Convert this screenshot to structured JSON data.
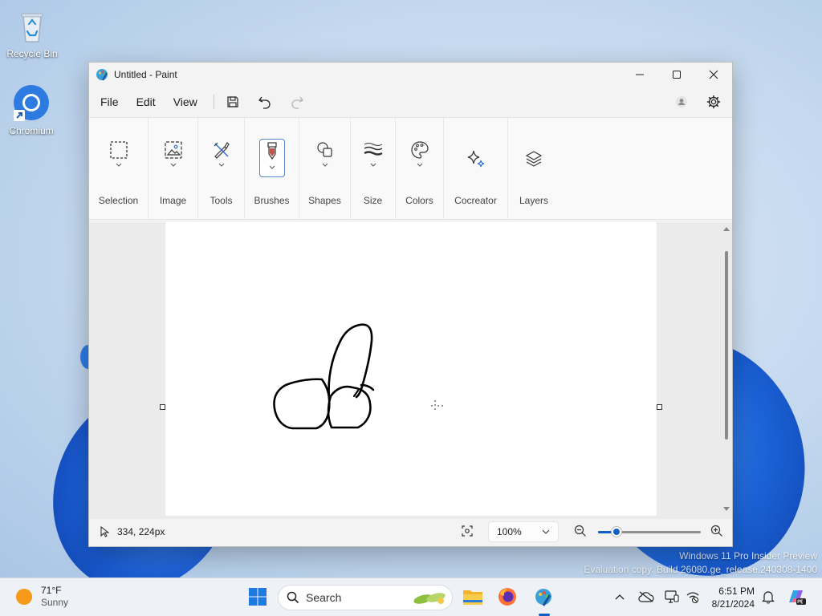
{
  "desktop": {
    "icons": [
      {
        "label": "Recycle Bin"
      },
      {
        "label": "Chromium"
      }
    ],
    "watermark": {
      "line1": "Windows 11 Pro Insider Preview",
      "line2": "Evaluation copy. Build 26080.ge_release.240308-1400"
    }
  },
  "window": {
    "title": "Untitled - Paint",
    "menu": {
      "file": "File",
      "edit": "Edit",
      "view": "View"
    },
    "ribbon": {
      "groups": [
        {
          "label": "Selection",
          "icon": "selection-icon"
        },
        {
          "label": "Image",
          "icon": "image-icon"
        },
        {
          "label": "Tools",
          "icon": "tools-icon"
        },
        {
          "label": "Brushes",
          "icon": "brush-icon"
        },
        {
          "label": "Shapes",
          "icon": "shapes-icon"
        },
        {
          "label": "Size",
          "icon": "size-icon"
        },
        {
          "label": "Colors",
          "icon": "palette-icon"
        },
        {
          "label": "Cocreator",
          "icon": "sparkle-icon"
        },
        {
          "label": "Layers",
          "icon": "layers-icon"
        }
      ]
    },
    "status": {
      "coordinates": "334, 224px",
      "zoom": "100%",
      "zoom_slider_fraction": 0.18
    }
  },
  "taskbar": {
    "weather": {
      "temp": "71°F",
      "condition": "Sunny"
    },
    "search_placeholder": "Search",
    "clock": {
      "time": "6:51 PM",
      "date": "8/21/2024"
    }
  },
  "colors": {
    "accent": "#0f5fc7",
    "window_bg": "#f3f3f3",
    "ribbon_bg": "#f9f9f9"
  }
}
